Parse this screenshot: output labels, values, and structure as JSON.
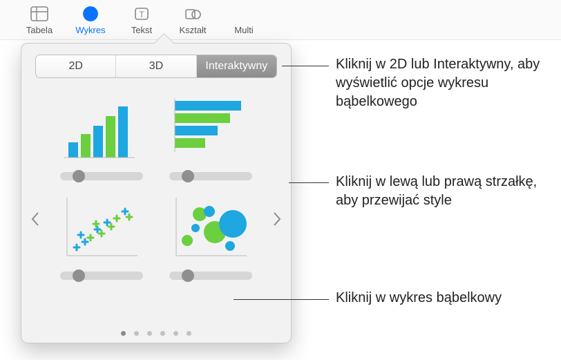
{
  "toolbar": {
    "items": [
      {
        "label": "Tabela"
      },
      {
        "label": "Wykres"
      },
      {
        "label": "Tekst"
      },
      {
        "label": "Kształt"
      },
      {
        "label": "Multi"
      }
    ]
  },
  "popover": {
    "tabs": {
      "t2d": "2D",
      "t3d": "3D",
      "inter": "Interaktywny"
    },
    "nav": {
      "prev": "‹",
      "next": "›"
    }
  },
  "callouts": {
    "c1": "Kliknij w 2D lub Interaktywny, aby wyświetlić opcje wykresu bąbelkowego",
    "c2": "Kliknij w lewą lub prawą strzałkę, aby przewijać style",
    "c3": "Kliknij w wykres bąbelkowy"
  },
  "colors": {
    "green": "#6bcf3f",
    "blue": "#1ea7e0"
  }
}
